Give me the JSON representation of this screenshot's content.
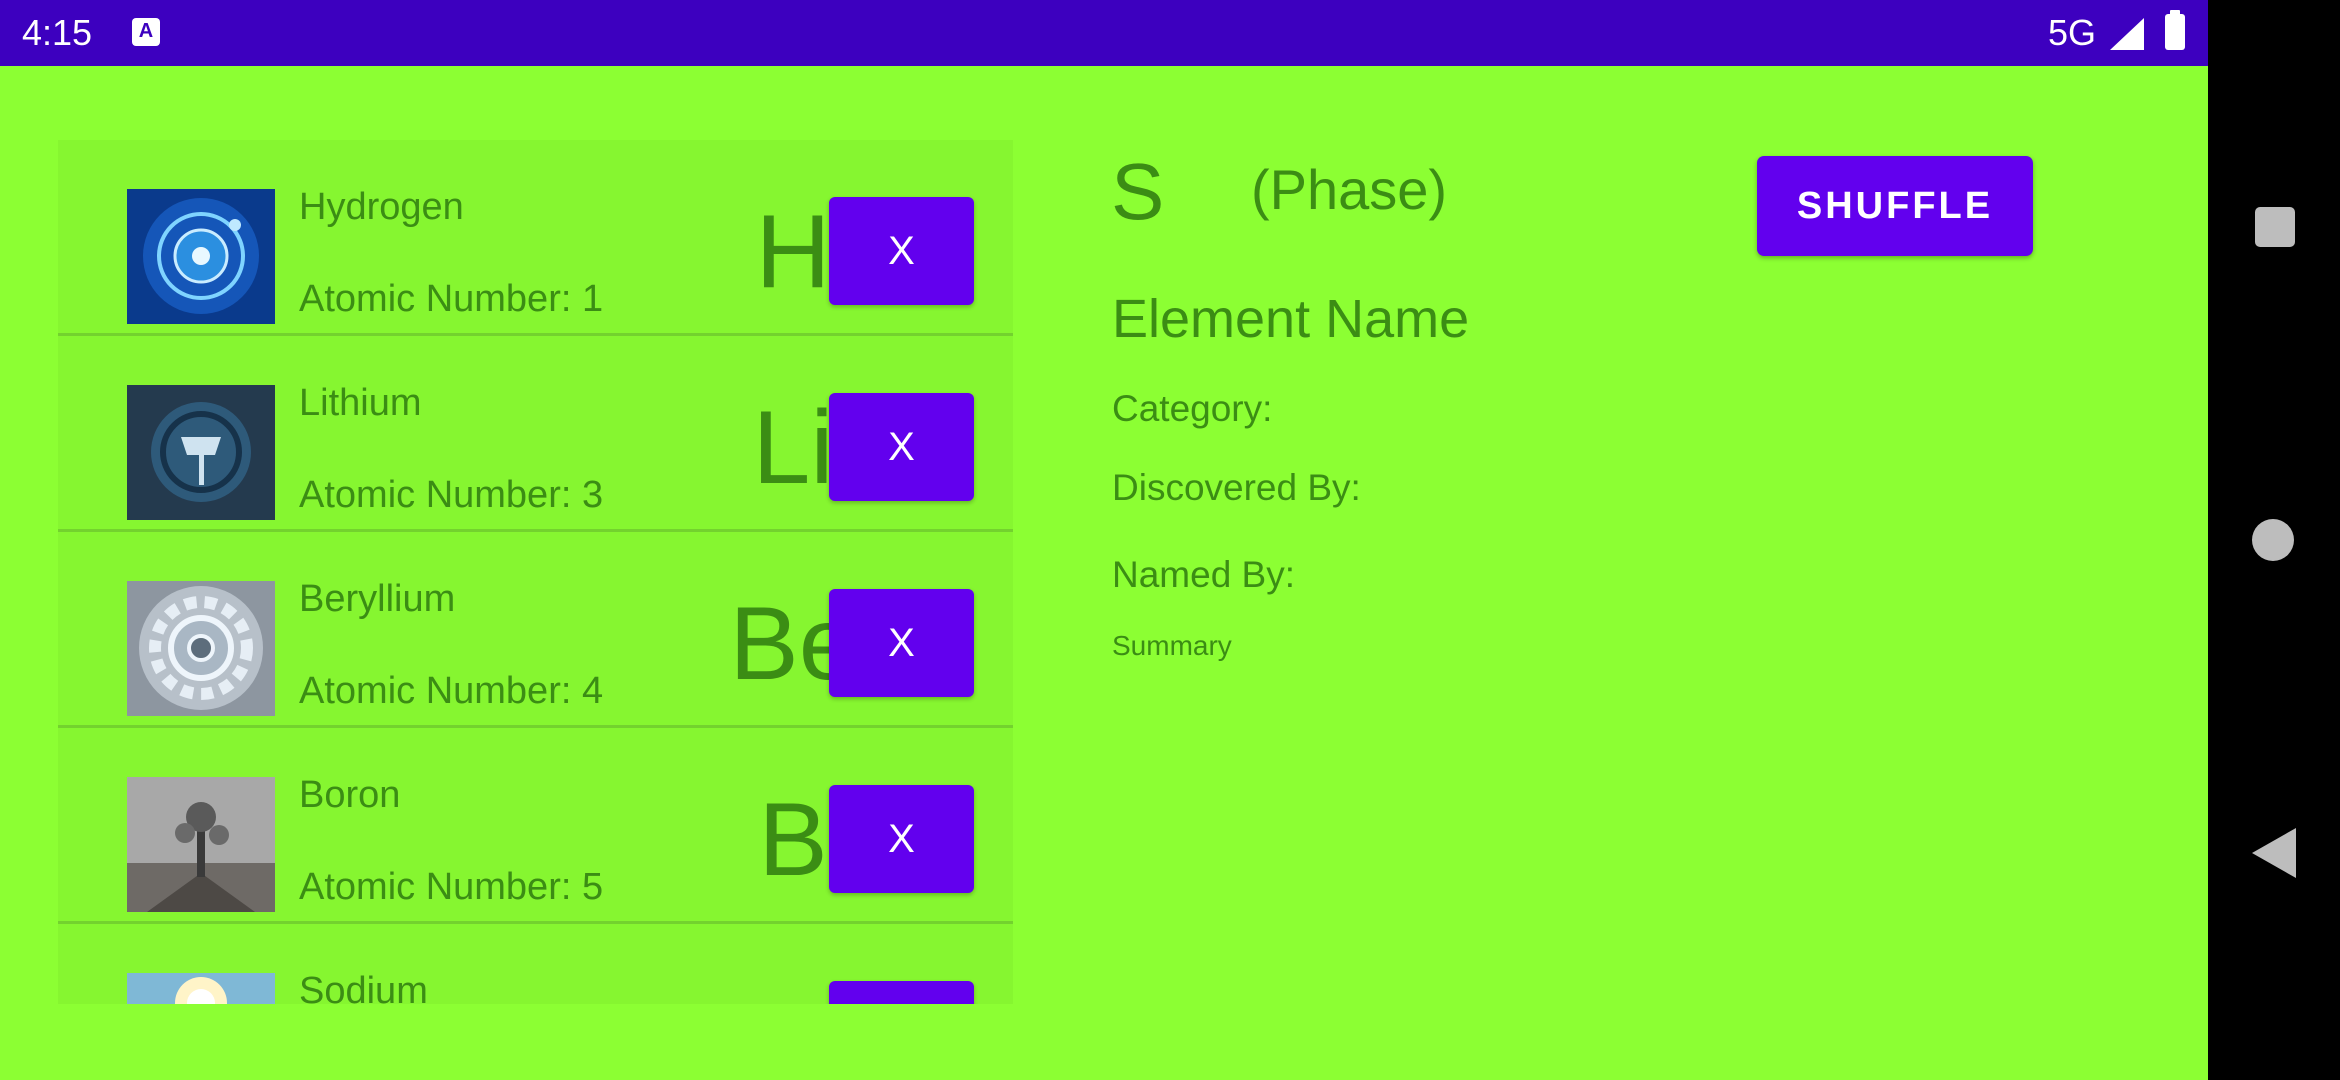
{
  "status_bar": {
    "time": "4:15",
    "network": "5G"
  },
  "elements": [
    {
      "name": "Hydrogen",
      "atomic_number": "Atomic Number: 1",
      "symbol": "H",
      "remove_label": "X"
    },
    {
      "name": "Lithium",
      "atomic_number": "Atomic Number: 3",
      "symbol": "Li",
      "remove_label": "X"
    },
    {
      "name": "Beryllium",
      "atomic_number": "Atomic Number: 4",
      "symbol": "Be",
      "remove_label": "X"
    },
    {
      "name": "Boron",
      "atomic_number": "Atomic Number: 5",
      "symbol": "B",
      "remove_label": "X"
    },
    {
      "name": "Sodium",
      "atomic_number": "",
      "symbol": "",
      "remove_label": ""
    }
  ],
  "detail": {
    "symbol": "S",
    "phase": "(Phase)",
    "element_name": "Element Name",
    "category_label": "Category:",
    "discovered_by_label": "Discovered By:",
    "named_by_label": "Named By:",
    "summary": "Summary"
  },
  "actions": {
    "shuffle_label": "SHUFFLE"
  },
  "colors": {
    "background": "#8cff33",
    "status_bar": "#3d00bf",
    "button": "#6200ee",
    "text": "#3b8d14"
  }
}
